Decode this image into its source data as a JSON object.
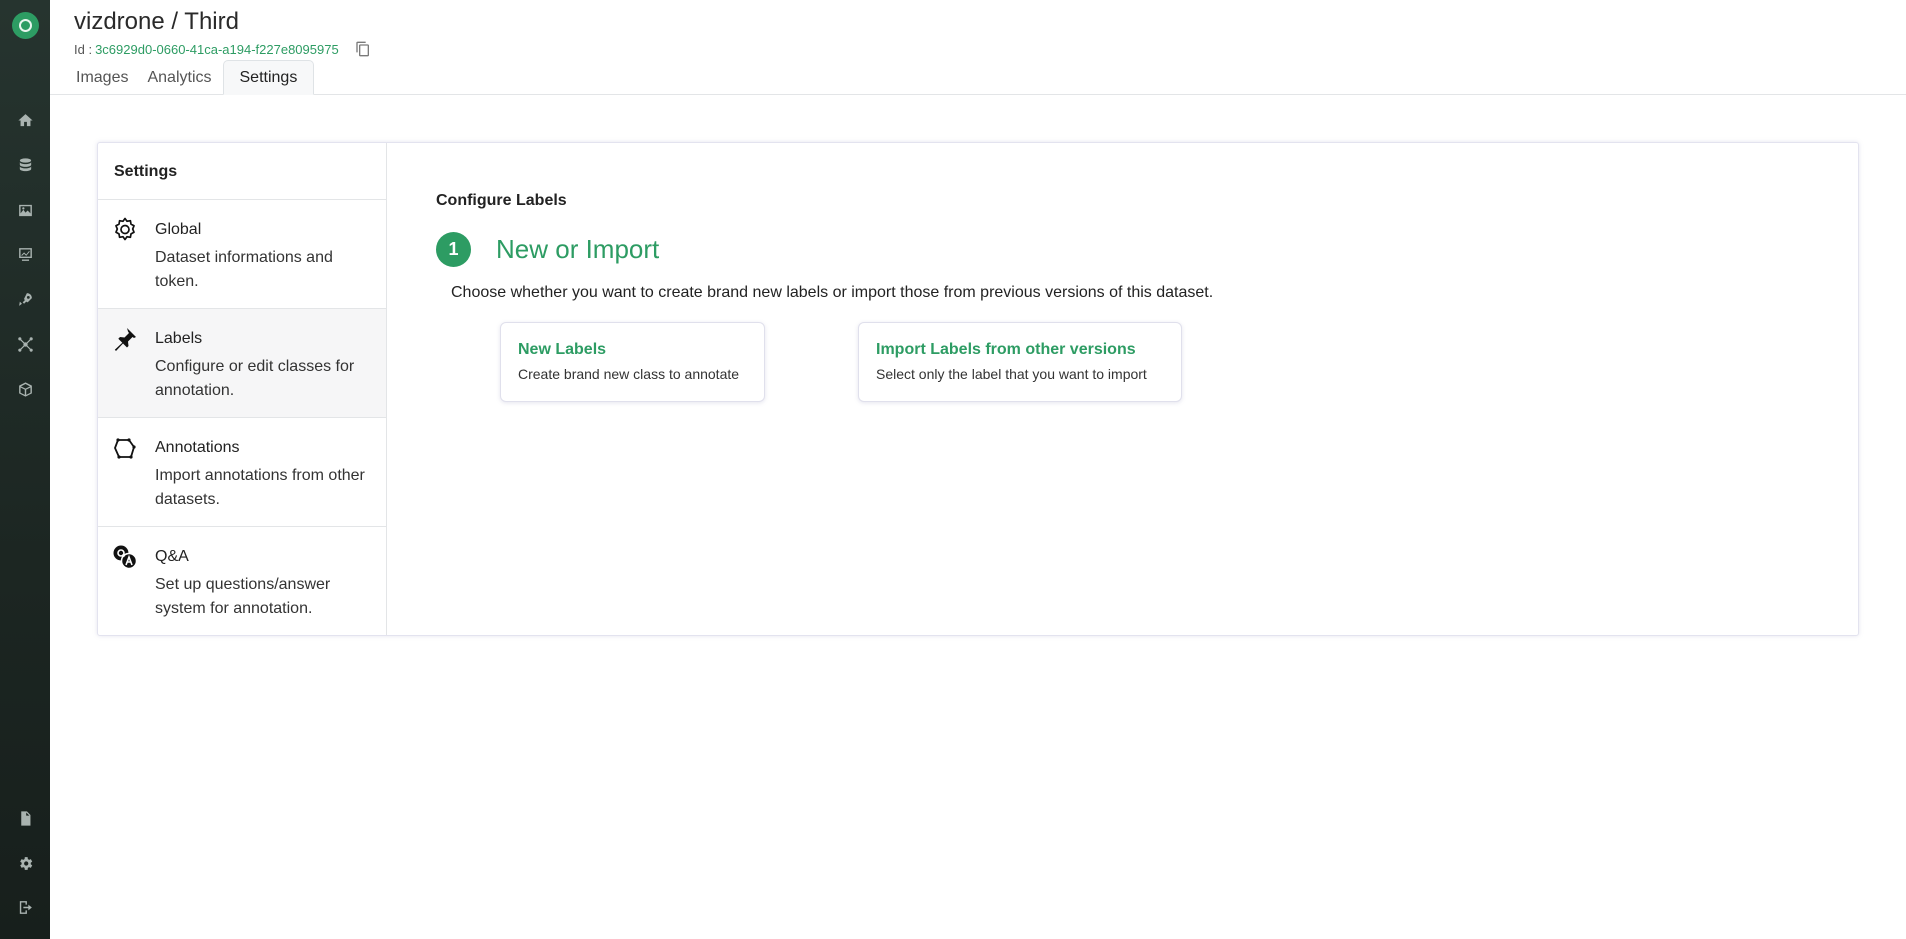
{
  "header": {
    "title": "vizdrone / Third",
    "id_label": "Id :",
    "id_value": "3c6929d0-0660-41ca-a194-f227e8095975",
    "tabs": [
      {
        "label": "Images",
        "active": false
      },
      {
        "label": "Analytics",
        "active": false
      },
      {
        "label": "Settings",
        "active": true
      }
    ]
  },
  "rail": {
    "icons": [
      "logo-icon",
      "home-icon",
      "database-icon",
      "image-icon",
      "analytics-icon",
      "deployment-icon",
      "network-icon",
      "package-icon",
      "document-icon",
      "gear-icon",
      "logout-icon"
    ]
  },
  "sidebar": {
    "title": "Settings",
    "items": [
      {
        "name": "Global",
        "desc": "Dataset informations and token.",
        "icon": "gear-icon",
        "active": false
      },
      {
        "name": "Labels",
        "desc": "Configure or edit classes for annotation.",
        "icon": "pin-icon",
        "active": true
      },
      {
        "name": "Annotations",
        "desc": "Import annotations from other datasets.",
        "icon": "polygon-icon",
        "active": false
      },
      {
        "name": "Q&A",
        "desc": "Set up questions/answer system for annotation.",
        "icon": "qa-icon",
        "active": false
      }
    ]
  },
  "content": {
    "section_title": "Configure Labels",
    "step_number": "1",
    "step_title": "New or Import",
    "step_desc": "Choose whether you want to create brand new labels or import those from previous versions of this dataset.",
    "choices": [
      {
        "title": "New Labels",
        "desc": "Create brand new class to annotate"
      },
      {
        "title": "Import Labels from other versions",
        "desc": "Select only the label that you want to import"
      }
    ]
  },
  "colors": {
    "accent": "#2d9c63",
    "rail": "#1f2b27"
  }
}
